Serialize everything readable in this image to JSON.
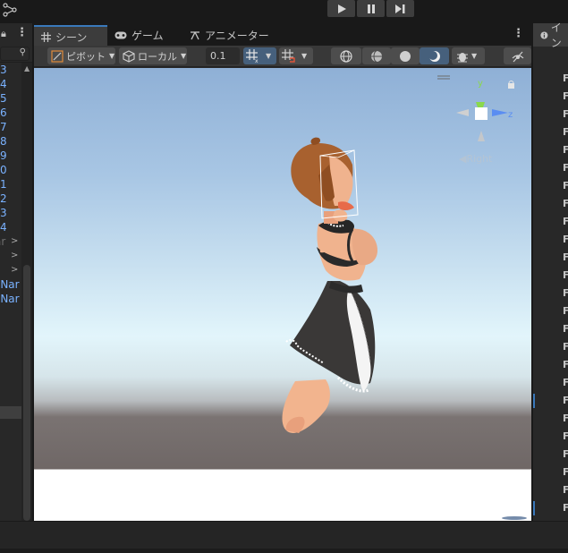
{
  "toolbar_top": {
    "icons": [
      "share-icon",
      "play-icon",
      "pause-icon",
      "step-icon"
    ]
  },
  "hierarchy": {
    "header_icons": [
      "lock-icon",
      "kebab-icon"
    ],
    "search_icon": "search-icon",
    "items": [
      "3",
      "4",
      "5",
      "6",
      "7",
      "8",
      "9",
      "0",
      "1",
      "2",
      "3",
      "4"
    ],
    "expanders": [
      "ar",
      ">",
      ">",
      ">"
    ],
    "extra_items": [
      "-Nar",
      "-Nar"
    ]
  },
  "scene_window": {
    "tabs": [
      {
        "label": "シーン",
        "icon": "grid-icon"
      },
      {
        "label": "ゲーム",
        "icon": "gamepad-icon"
      },
      {
        "label": "アニメーター",
        "icon": "animator-icon"
      }
    ],
    "toolbar": {
      "pivot_label": "ピボット",
      "local_label": "ローカル",
      "snap_value": "0.1"
    },
    "gizmo": {
      "y_label": "y",
      "z_label": "z",
      "view_label": "Right",
      "colors": {
        "y": "#8ad94b",
        "z": "#5a8df2",
        "x": "#d8d8d8"
      }
    }
  },
  "inspector": {
    "tab_label": "イン",
    "tab_icon": "info-icon",
    "rows": [
      "F",
      "F",
      "F",
      "F",
      "F",
      "F",
      "F",
      "F",
      "F",
      "F",
      "F",
      "F",
      "F",
      "F",
      "F",
      "F",
      "F",
      "F",
      "F",
      "F",
      "F",
      "F",
      "F",
      "F",
      "F",
      "F"
    ]
  }
}
